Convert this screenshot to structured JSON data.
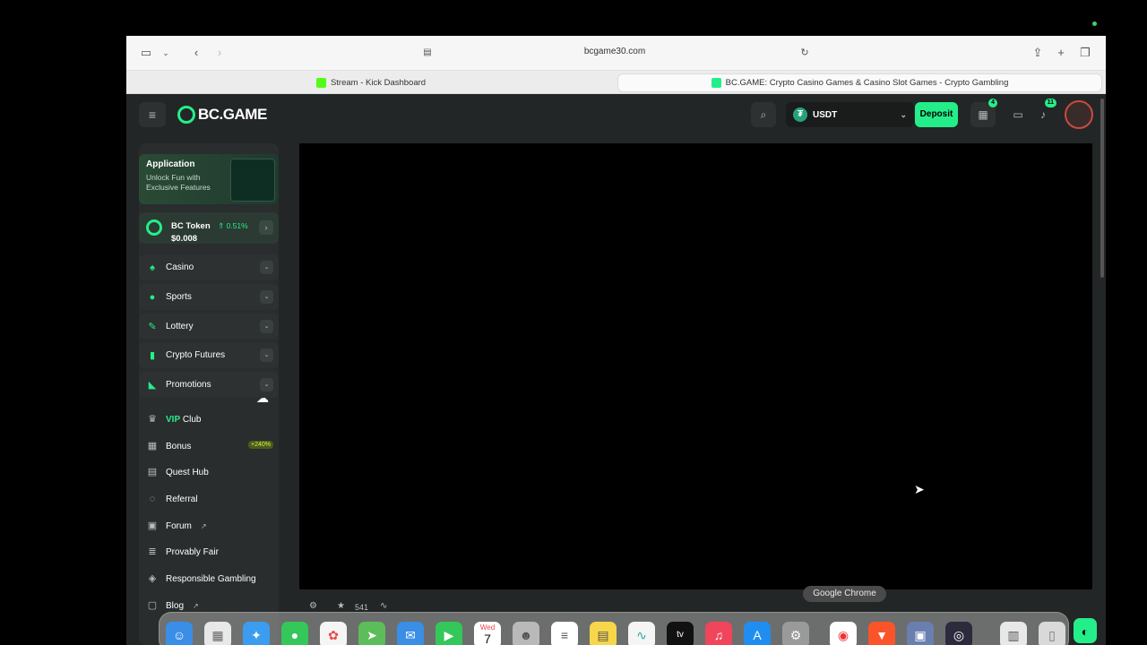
{
  "browser": {
    "url": "bcgame30.com",
    "tabs": [
      {
        "label": "Stream - Kick Dashboard",
        "favicon_color": "#53fc18"
      },
      {
        "label": "BC.GAME: Crypto Casino Games & Casino Slot Games - Crypto Gambling",
        "favicon_color": "#24ee89"
      }
    ]
  },
  "header": {
    "logo": "BC.GAME",
    "currency": "USDT",
    "deposit": "Deposit",
    "gift_count": "4",
    "notif_count": "11"
  },
  "sidebar": {
    "app_card": {
      "title": "Application",
      "subtitle": "Unlock Fun with Exclusive Features"
    },
    "token": {
      "name": "BC Token",
      "change": "0.51%",
      "price": "$0.008"
    },
    "groups": [
      {
        "label": "Casino",
        "icon": "cards-icon"
      },
      {
        "label": "Sports",
        "icon": "ball-icon"
      },
      {
        "label": "Lottery",
        "icon": "ticket-icon"
      },
      {
        "label": "Crypto Futures",
        "icon": "chart-icon"
      },
      {
        "label": "Promotions",
        "icon": "megaphone-icon"
      }
    ],
    "vip": {
      "prefix": "VIP",
      "suffix": "Club"
    },
    "items": [
      {
        "label": "Bonus",
        "badge": "+240%"
      },
      {
        "label": "Quest Hub"
      },
      {
        "label": "Referral"
      },
      {
        "label": "Forum"
      },
      {
        "label": "Provably Fair"
      },
      {
        "label": "Responsible Gambling"
      },
      {
        "label": "Blog"
      }
    ]
  },
  "bottom_bar": {
    "favorites": "541"
  },
  "dock": {
    "tooltip": "Google Chrome",
    "calendar_day": "Wed",
    "calendar_date": "7"
  },
  "colors": {
    "accent": "#24ee89",
    "background": "#232626",
    "sidebar": "#292d2d"
  }
}
